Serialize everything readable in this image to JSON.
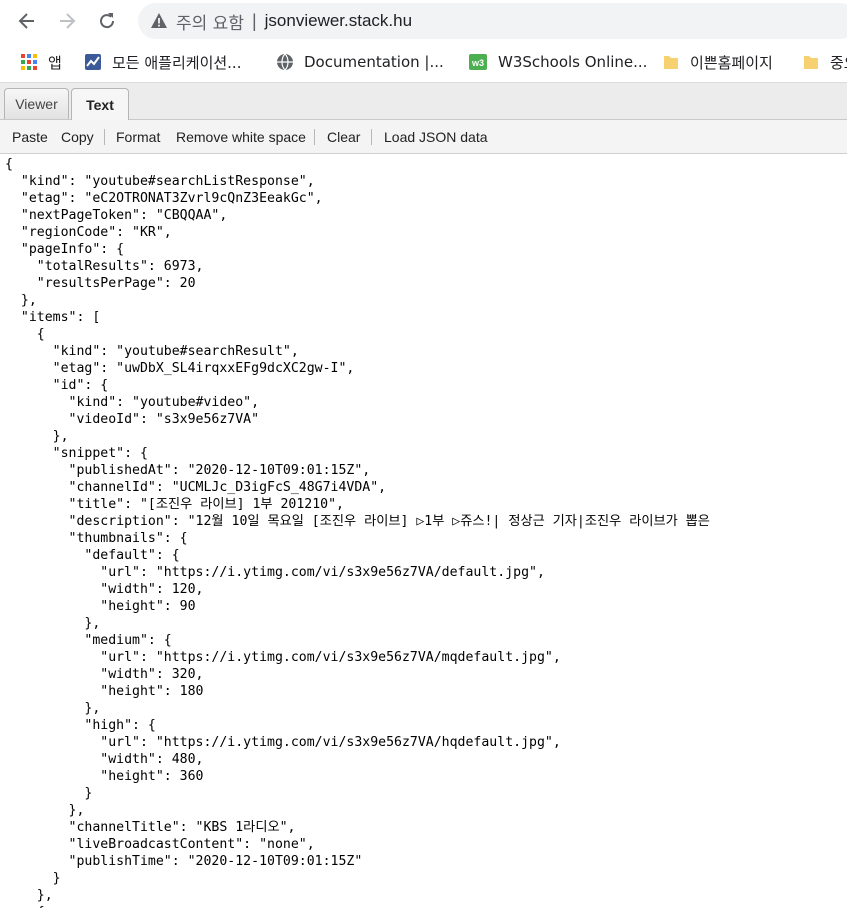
{
  "browser": {
    "security_label": "주의 요함",
    "separator": "|",
    "url": "jsonviewer.stack.hu"
  },
  "bookmarks": [
    {
      "label": "앱",
      "icon": "apps-grid-icon"
    },
    {
      "label": "모든 애플리케이션...",
      "icon": "chart-app-icon"
    },
    {
      "label": "Documentation  |...",
      "icon": "globe-icon"
    },
    {
      "label": "W3Schools Online...",
      "icon": "w3schools-icon"
    },
    {
      "label": "이쁜홈페이지",
      "icon": "folder-icon"
    },
    {
      "label": "중요",
      "icon": "folder-icon"
    }
  ],
  "tabs": [
    {
      "label": "Viewer"
    },
    {
      "label": "Text"
    }
  ],
  "toolbar": {
    "paste": "Paste",
    "copy": "Copy",
    "format": "Format",
    "remove_ws": "Remove white space",
    "clear": "Clear",
    "load_json": "Load JSON data"
  },
  "editor": {
    "lines": [
      "{",
      "  \"kind\": \"youtube#searchListResponse\",",
      "  \"etag\": \"eC2OTRONAT3Zvrl9cQnZ3EeakGc\",",
      "  \"nextPageToken\": \"CBQQAA\",",
      "  \"regionCode\": \"KR\",",
      "  \"pageInfo\": {",
      "    \"totalResults\": 6973,",
      "    \"resultsPerPage\": 20",
      "  },",
      "  \"items\": [",
      "    {",
      "      \"kind\": \"youtube#searchResult\",",
      "      \"etag\": \"uwDbX_SL4irqxxEFg9dcXC2gw-I\",",
      "      \"id\": {",
      "        \"kind\": \"youtube#video\",",
      "        \"videoId\": \"s3x9e56z7VA\"",
      "      },",
      "      \"snippet\": {",
      "        \"publishedAt\": \"2020-12-10T09:01:15Z\",",
      "        \"channelId\": \"UCMLJc_D3igFcS_48G7i4VDA\",",
      "        \"title\": \"[조진우 라이브] 1부 201210\",",
      "        \"description\": \"12월 10일 목요일 [조진우 라이브] ▷1부 ▷쥬스!| 정상근 기자|조진우 라이브가 뽑은",
      "        \"thumbnails\": {",
      "          \"default\": {",
      "            \"url\": \"https://i.ytimg.com/vi/s3x9e56z7VA/default.jpg\",",
      "            \"width\": 120,",
      "            \"height\": 90",
      "          },",
      "          \"medium\": {",
      "            \"url\": \"https://i.ytimg.com/vi/s3x9e56z7VA/mqdefault.jpg\",",
      "            \"width\": 320,",
      "            \"height\": 180",
      "          },",
      "          \"high\": {",
      "            \"url\": \"https://i.ytimg.com/vi/s3x9e56z7VA/hqdefault.jpg\",",
      "            \"width\": 480,",
      "            \"height\": 360",
      "          }",
      "        },",
      "        \"channelTitle\": \"KBS 1라디오\",",
      "        \"liveBroadcastContent\": \"none\",",
      "        \"publishTime\": \"2020-12-10T09:01:15Z\"",
      "      }",
      "    },",
      "    {"
    ]
  }
}
